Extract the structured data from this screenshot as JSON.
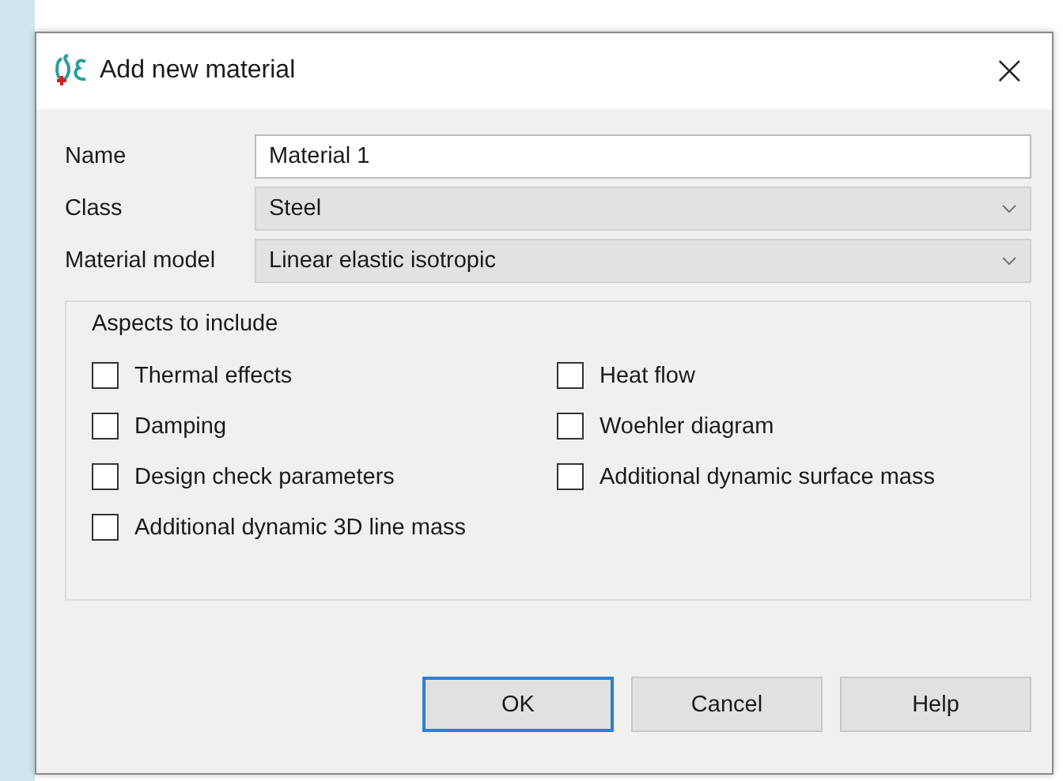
{
  "window": {
    "title": "Add new material",
    "close": "×"
  },
  "fields": [
    {
      "kind": "text",
      "label": "Name",
      "value": "Material 1"
    },
    {
      "kind": "dropdown",
      "label": "Class",
      "value": "Steel"
    },
    {
      "kind": "dropdown",
      "label": "Material model",
      "value": "Linear elastic isotropic"
    }
  ],
  "aspects": {
    "title": "Aspects to include",
    "options": [
      {
        "label": "Thermal effects",
        "checked": false
      },
      {
        "label": "Heat flow",
        "checked": false
      },
      {
        "label": "Damping",
        "checked": false
      },
      {
        "label": "Woehler diagram",
        "checked": false
      },
      {
        "label": "Design check parameters",
        "checked": false
      },
      {
        "label": "Additional dynamic surface mass",
        "checked": false
      },
      {
        "label": "Additional dynamic 3D line mass",
        "checked": false
      }
    ]
  },
  "buttons": [
    {
      "label": "OK",
      "default": true
    },
    {
      "label": "Cancel",
      "default": false
    },
    {
      "label": "Help",
      "default": false
    }
  ]
}
